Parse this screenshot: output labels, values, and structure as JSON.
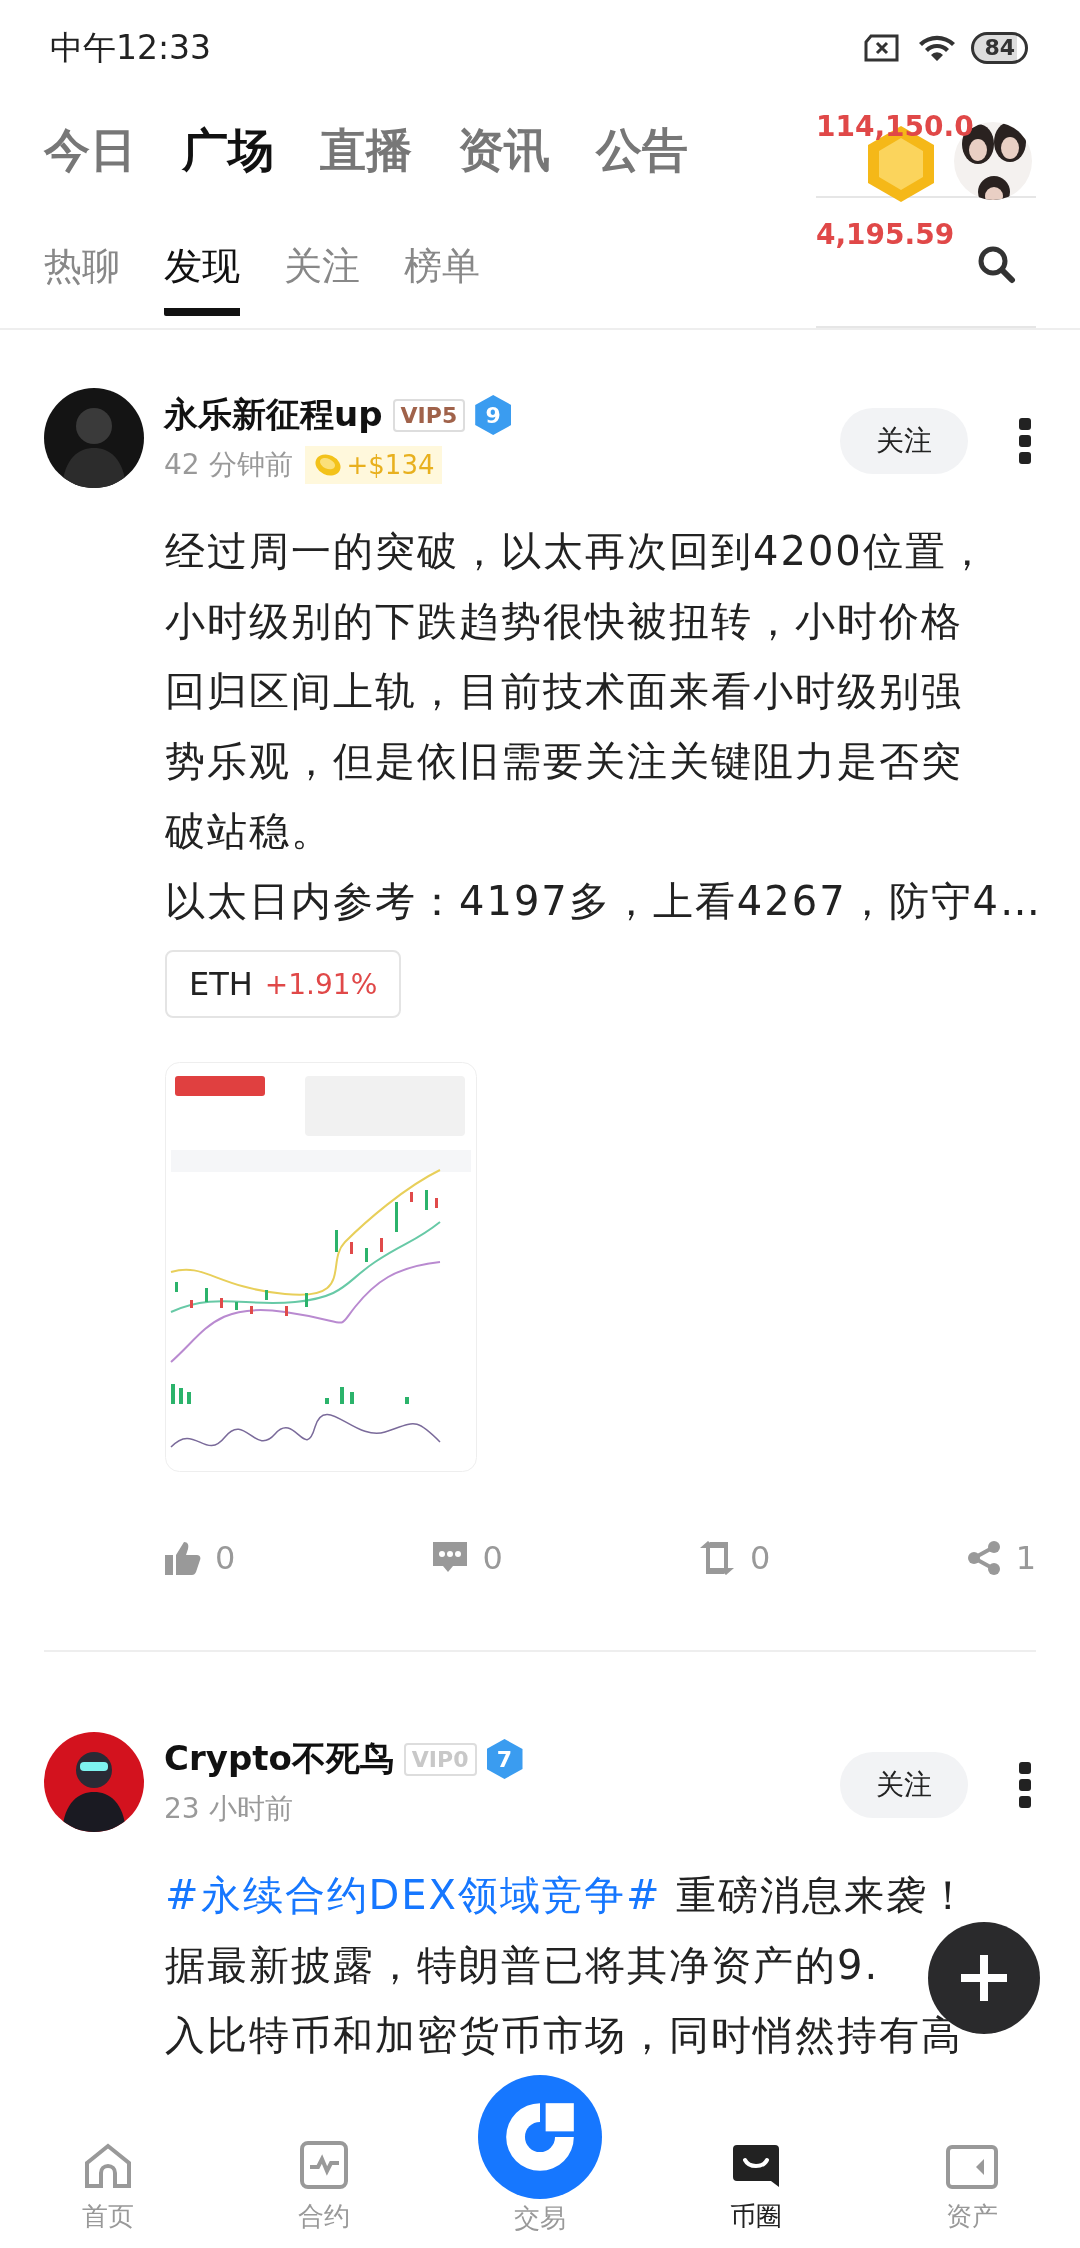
{
  "status_bar": {
    "time": "中午12:33",
    "battery": "84"
  },
  "main_tabs": [
    {
      "label": "今日",
      "selected": false
    },
    {
      "label": "广场",
      "selected": true
    },
    {
      "label": "直播",
      "selected": false
    },
    {
      "label": "资讯",
      "selected": false
    },
    {
      "label": "公告",
      "selected": false
    }
  ],
  "sub_tabs": [
    {
      "label": "热聊",
      "selected": false
    },
    {
      "label": "发现",
      "selected": true
    },
    {
      "label": "关注",
      "selected": false
    },
    {
      "label": "榜单",
      "selected": false
    }
  ],
  "ticker": [
    "114,150.0",
    "4,195.59"
  ],
  "posts": [
    {
      "author": "永乐新征程up",
      "vip": "VIP5",
      "vip_active": true,
      "level": "9",
      "time": "42 分钟前",
      "reward": "+$134",
      "follow": "关注",
      "lines": [
        "经过周一的突破，以太再次回到4200位置，",
        "小时级别的下跌趋势很快被扭转，小时价格",
        "回归区间上轨，目前技术面来看小时级别强",
        "势乐观，但是依旧需要关注关键阻力是否突",
        "破站稳。",
        "以太日内参考：4197多，上看4267，防守4…"
      ],
      "tag": {
        "symbol": "ETH",
        "change": "+1.91%"
      },
      "image": {
        "kind": "picture"
      },
      "actions": [
        {
          "kind": "like",
          "count": "0"
        },
        {
          "kind": "comment",
          "count": "0"
        },
        {
          "kind": "repost",
          "count": "0"
        },
        {
          "kind": "share",
          "count": "1"
        }
      ]
    },
    {
      "author": "Crypto不死鸟",
      "vip": "VIP0",
      "vip_active": false,
      "level": "7",
      "time": "23 小时前",
      "follow": "关注",
      "topic": "#永续合约DEX领域竞争#",
      "lines": [
        "重磅消息来袭！",
        "据最新披露，特朗普已将其净资产的9.",
        "入比特币和加密货币市场，同时悄然持有高"
      ]
    }
  ],
  "nav": [
    {
      "kind": "home",
      "label": "首页",
      "selected": false
    },
    {
      "kind": "contract",
      "label": "合约",
      "selected": false
    },
    {
      "kind": "trade",
      "label": "交易",
      "selected": false
    },
    {
      "kind": "feed",
      "label": "币圈",
      "selected": true
    },
    {
      "kind": "assets",
      "label": "资产",
      "selected": false
    }
  ]
}
